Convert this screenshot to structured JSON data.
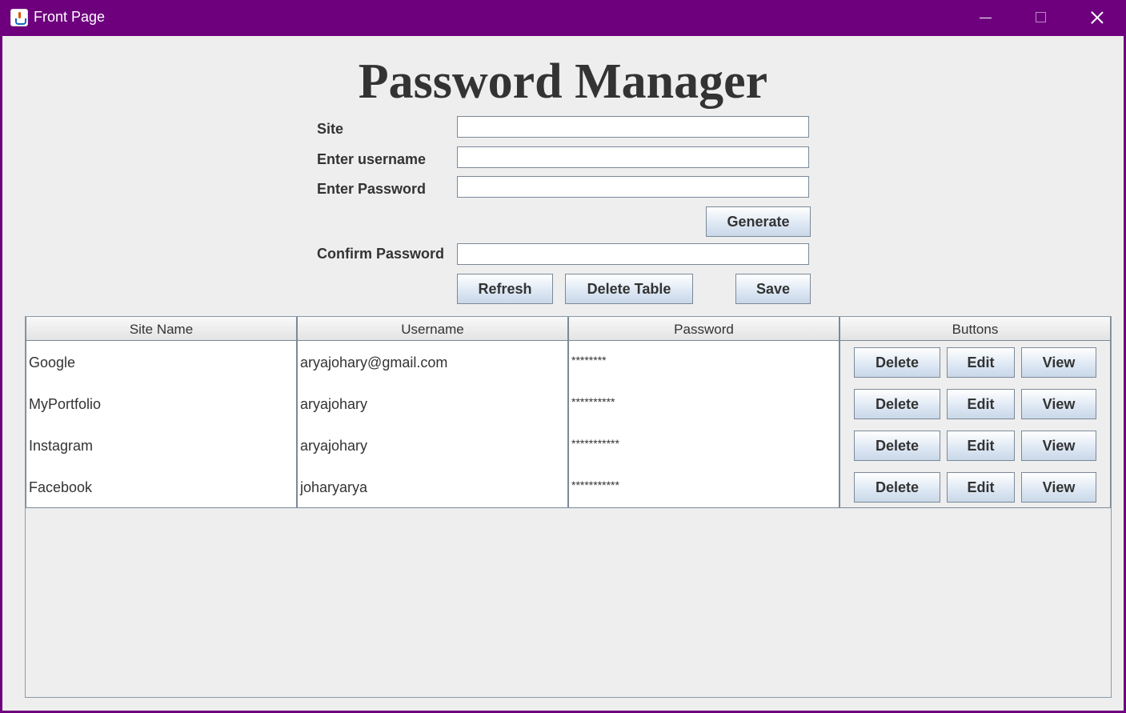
{
  "window": {
    "title": "Front Page"
  },
  "heading": "Password Manager",
  "form": {
    "site_label": "Site",
    "username_label": "Enter username",
    "password_label": "Enter Password",
    "confirm_label": "Confirm Password",
    "site_value": "",
    "username_value": "",
    "password_value": "",
    "confirm_value": ""
  },
  "buttons": {
    "generate": "Generate",
    "refresh": "Refresh",
    "delete_table": "Delete Table",
    "save": "Save"
  },
  "table": {
    "columns": [
      "Site Name",
      "Username",
      "Password",
      "Buttons"
    ],
    "rows": [
      {
        "site": "Google",
        "username": "aryajohary@gmail.com",
        "password": "********",
        "delete": "Delete",
        "edit": "Edit",
        "view": "View"
      },
      {
        "site": "MyPortfolio",
        "username": "aryajohary",
        "password": "**********",
        "delete": "Delete",
        "edit": "Edit",
        "view": "View"
      },
      {
        "site": "Instagram",
        "username": "aryajohary",
        "password": "***********",
        "delete": "Delete",
        "edit": "Edit",
        "view": "View"
      },
      {
        "site": "Facebook",
        "username": "joharyarya",
        "password": "***********",
        "delete": "Delete",
        "edit": "Edit",
        "view": "View"
      }
    ]
  },
  "colors": {
    "titlebar": "#6e007e",
    "background": "#eeeeee"
  }
}
